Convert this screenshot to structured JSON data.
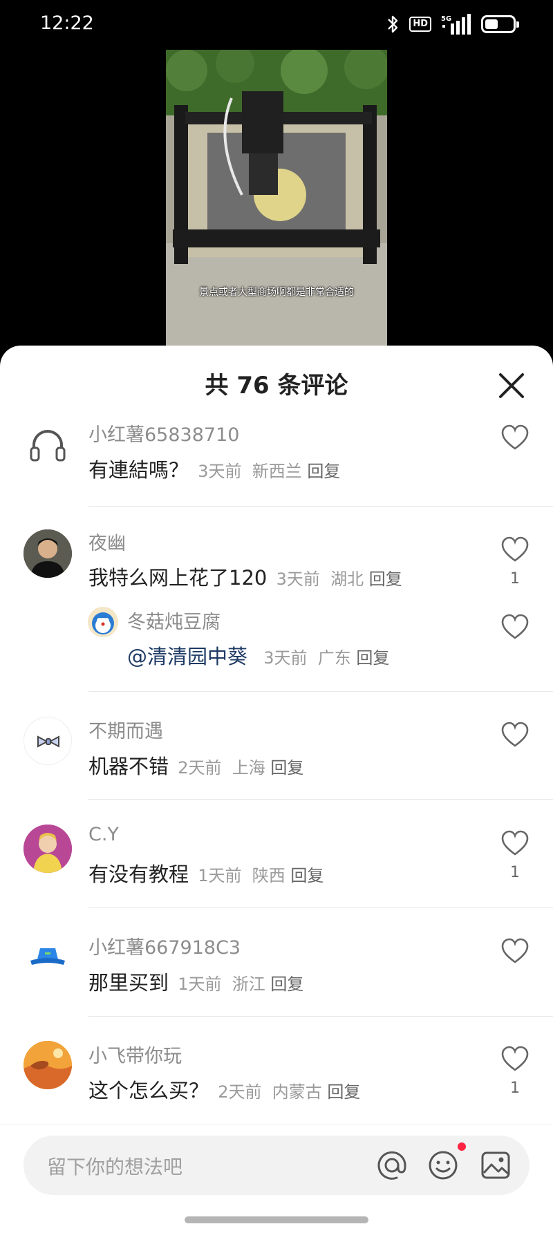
{
  "status_bar": {
    "time": "12:22",
    "hd_label": "HD",
    "network_label": "5G"
  },
  "video": {
    "caption": "景点或者大型商场啊都是非常合适的"
  },
  "comments_panel": {
    "title": "共 76 条评论"
  },
  "comments": [
    {
      "user": "小红薯65838710",
      "text": "有連結嗎？",
      "time": "3天前",
      "location": "新西兰",
      "reply": "回复",
      "likes": "",
      "avatar_icon": "headphones-icon"
    },
    {
      "user": "夜幽",
      "text": "我特么网上花了120",
      "time": "3天前",
      "location": "湖北",
      "reply": "回复",
      "likes": "1",
      "avatar_icon": "person-photo"
    },
    {
      "user": "冬菇炖豆腐",
      "text": "@清清园中葵",
      "time": "3天前",
      "location": "广东",
      "reply": "回复",
      "likes": "",
      "avatar_icon": "cartoon-cat-icon"
    },
    {
      "user": "不期而遇",
      "text": "机器不错",
      "time": "2天前",
      "location": "上海",
      "reply": "回复",
      "likes": "",
      "avatar_icon": "bow-tie-icon"
    },
    {
      "user": "C.Y",
      "text": "有没有教程",
      "time": "1天前",
      "location": "陕西",
      "reply": "回复",
      "likes": "1",
      "avatar_icon": "child-photo"
    },
    {
      "user": "小红薯667918C3",
      "text": "那里买到",
      "time": "1天前",
      "location": "浙江",
      "reply": "回复",
      "likes": "",
      "avatar_icon": "bucket-hat-icon"
    },
    {
      "user": "小飞带你玩",
      "text": "这个怎么买？",
      "time": "2天前",
      "location": "内蒙古",
      "reply": "回复",
      "likes": "1",
      "avatar_icon": "desert-photo"
    }
  ],
  "input": {
    "placeholder": "留下你的想法吧"
  },
  "colors": {
    "accent_red": "#ff2442",
    "mention_blue": "#1e3a64"
  }
}
